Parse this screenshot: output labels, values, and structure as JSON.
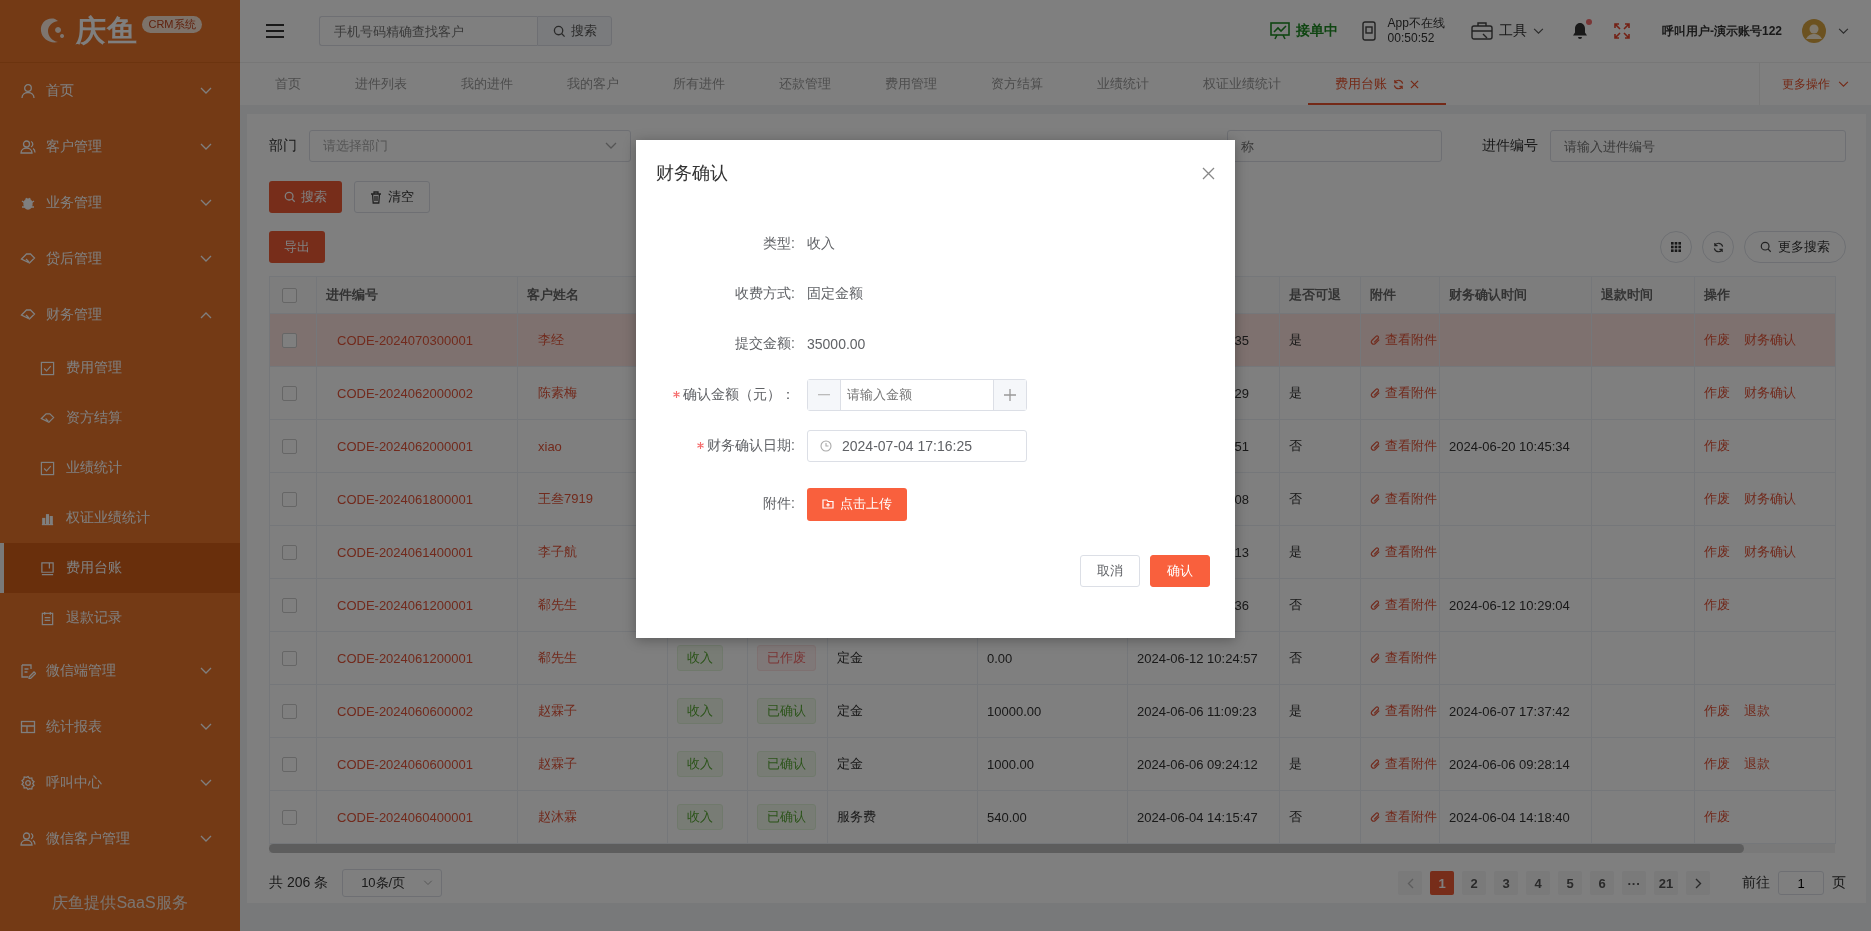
{
  "sidebar": {
    "logo": {
      "name": "庆鱼",
      "badge": "CRM系统"
    },
    "items": [
      {
        "label": "首页",
        "expanded": false
      },
      {
        "label": "客户管理",
        "expanded": false
      },
      {
        "label": "业务管理",
        "expanded": false
      },
      {
        "label": "贷后管理",
        "expanded": false
      },
      {
        "label": "财务管理",
        "expanded": true,
        "children": [
          {
            "label": "费用管理",
            "selected": false
          },
          {
            "label": "资方结算",
            "selected": false
          },
          {
            "label": "业绩统计",
            "selected": false
          },
          {
            "label": "权证业绩统计",
            "selected": false
          },
          {
            "label": "费用台账",
            "selected": true
          },
          {
            "label": "退款记录",
            "selected": false
          }
        ]
      },
      {
        "label": "微信端管理",
        "expanded": false
      },
      {
        "label": "统计报表",
        "expanded": false
      },
      {
        "label": "呼叫中心",
        "expanded": false
      },
      {
        "label": "微信客户管理",
        "expanded": false
      }
    ],
    "footer": "庆鱼提供SaaS服务"
  },
  "topbar": {
    "search": {
      "placeholder": "手机号码精确查找客户",
      "button": "搜索"
    },
    "status": "接单中",
    "app_status": "App不在线",
    "app_time": "00:50:52",
    "tools": "工具",
    "notification_dot": true,
    "user": "呼叫用户-演示账号122"
  },
  "tabs": [
    {
      "label": "首页",
      "selected": false
    },
    {
      "label": "进件列表",
      "selected": false
    },
    {
      "label": "我的进件",
      "selected": false
    },
    {
      "label": "我的客户",
      "selected": false
    },
    {
      "label": "所有进件",
      "selected": false
    },
    {
      "label": "还款管理",
      "selected": false
    },
    {
      "label": "费用管理",
      "selected": false
    },
    {
      "label": "资方结算",
      "selected": false
    },
    {
      "label": "业绩统计",
      "selected": false
    },
    {
      "label": "权证业绩统计",
      "selected": false
    },
    {
      "label": "费用台账",
      "selected": true
    }
  ],
  "more_actions": "更多操作",
  "filters": [
    {
      "kind": "select",
      "label": "部门",
      "placeholder": "请选择部门"
    },
    {
      "kind": "input",
      "placeholder": "称"
    },
    {
      "kind": "input",
      "label": "进件编号",
      "placeholder": "请输入进件编号"
    }
  ],
  "actions": {
    "search": "搜索",
    "clear": "清空",
    "export": "导出",
    "more_search": "更多搜索"
  },
  "table": {
    "all_checked": false,
    "columns": [
      "进件编号",
      "客户姓名",
      "是否可退",
      "附件",
      "财务确认时间",
      "退款时间",
      "操作"
    ],
    "rows": [
      {
        "checked": false,
        "highlighted": true,
        "code": "CODE-2024070300001",
        "name": "李经",
        "submit_time_tail": "35",
        "refundable": "是",
        "attachment": "查看附件",
        "actions": [
          "作废",
          "财务确认"
        ]
      },
      {
        "checked": false,
        "highlighted": false,
        "code": "CODE-2024062000002",
        "name": "陈素梅",
        "submit_time_tail": "29",
        "refundable": "是",
        "attachment": "查看附件",
        "actions": [
          "作废",
          "财务确认"
        ]
      },
      {
        "checked": false,
        "highlighted": false,
        "code": "CODE-2024062000001",
        "name": "xiao",
        "submit_time_tail": "51",
        "refundable": "否",
        "attachment": "查看附件",
        "confirm_time": "2024-06-20 10:45:34",
        "actions": [
          "作废"
        ]
      },
      {
        "checked": false,
        "highlighted": false,
        "code": "CODE-2024061800001",
        "name": "王叁7919",
        "submit_time_tail": "08",
        "refundable": "否",
        "attachment": "查看附件",
        "actions": [
          "作废",
          "财务确认"
        ]
      },
      {
        "checked": false,
        "highlighted": false,
        "code": "CODE-2024061400001",
        "name": "李子航",
        "submit_time_tail": "13",
        "refundable": "是",
        "attachment": "查看附件",
        "actions": [
          "作废",
          "财务确认"
        ]
      },
      {
        "checked": false,
        "highlighted": false,
        "code": "CODE-2024061200001",
        "name": "郗先生",
        "submit_time_tail": "36",
        "refundable": "否",
        "attachment": "查看附件",
        "confirm_time": "2024-06-12 10:29:04",
        "actions": [
          "作废"
        ]
      },
      {
        "checked": false,
        "highlighted": false,
        "code": "CODE-2024061200001",
        "name": "郗先生",
        "type": "收入",
        "status": {
          "label": "已作废",
          "kind": "void"
        },
        "fee_type": "定金",
        "amount": "0.00",
        "submit_time": "2024-06-12 10:24:57",
        "refundable": "否",
        "attachment": "查看附件",
        "actions": []
      },
      {
        "checked": false,
        "highlighted": false,
        "code": "CODE-2024060600002",
        "name": "赵霖子",
        "type": "收入",
        "status": {
          "label": "已确认",
          "kind": "confirmed"
        },
        "fee_type": "定金",
        "amount": "10000.00",
        "submit_time": "2024-06-06 11:09:23",
        "refundable": "是",
        "attachment": "查看附件",
        "confirm_time": "2024-06-07 17:37:42",
        "actions": [
          "作废",
          "退款"
        ]
      },
      {
        "checked": false,
        "highlighted": false,
        "code": "CODE-2024060600001",
        "name": "赵霖子",
        "type": "收入",
        "status": {
          "label": "已确认",
          "kind": "confirmed"
        },
        "fee_type": "定金",
        "amount": "1000.00",
        "submit_time": "2024-06-06 09:24:12",
        "refundable": "是",
        "attachment": "查看附件",
        "confirm_time": "2024-06-06 09:28:14",
        "actions": [
          "作废",
          "退款"
        ]
      },
      {
        "checked": false,
        "highlighted": false,
        "code": "CODE-2024060400001",
        "name": "赵沐霖",
        "type": "收入",
        "status": {
          "label": "已确认",
          "kind": "confirmed"
        },
        "fee_type": "服务费",
        "amount": "540.00",
        "submit_time": "2024-06-04 14:15:47",
        "refundable": "否",
        "attachment": "查看附件",
        "confirm_time": "2024-06-04 14:18:40",
        "actions": [
          "作废"
        ]
      }
    ]
  },
  "pagination": {
    "total": "共 206 条",
    "page_size": "10条/页",
    "pages": [
      {
        "label": "1",
        "selected": true
      },
      {
        "label": "2",
        "selected": false
      },
      {
        "label": "3",
        "selected": false
      },
      {
        "label": "4",
        "selected": false
      },
      {
        "label": "5",
        "selected": false
      },
      {
        "label": "6",
        "selected": false
      },
      {
        "label": "···",
        "selected": false
      },
      {
        "label": "21",
        "selected": false
      }
    ],
    "goto_label": "前往",
    "goto_value": "1",
    "goto_suffix": "页"
  },
  "modal": {
    "title": "财务确认",
    "fields": [
      {
        "kind": "text",
        "label": "类型:",
        "value": "收入"
      },
      {
        "kind": "text",
        "label": "收费方式:",
        "value": "固定金额"
      },
      {
        "kind": "text",
        "label": "提交金额:",
        "value": "35000.00"
      },
      {
        "kind": "number",
        "label": "确认金额（元）：",
        "required": true,
        "placeholder": "请输入金额"
      },
      {
        "kind": "date",
        "label": "财务确认日期:",
        "required": true,
        "value": "2024-07-04 17:16:25"
      },
      {
        "kind": "upload",
        "label": "附件:",
        "button": "点击上传"
      }
    ],
    "buttons": [
      {
        "label": "取消",
        "kind": "default"
      },
      {
        "label": "确认",
        "kind": "primary"
      }
    ]
  }
}
